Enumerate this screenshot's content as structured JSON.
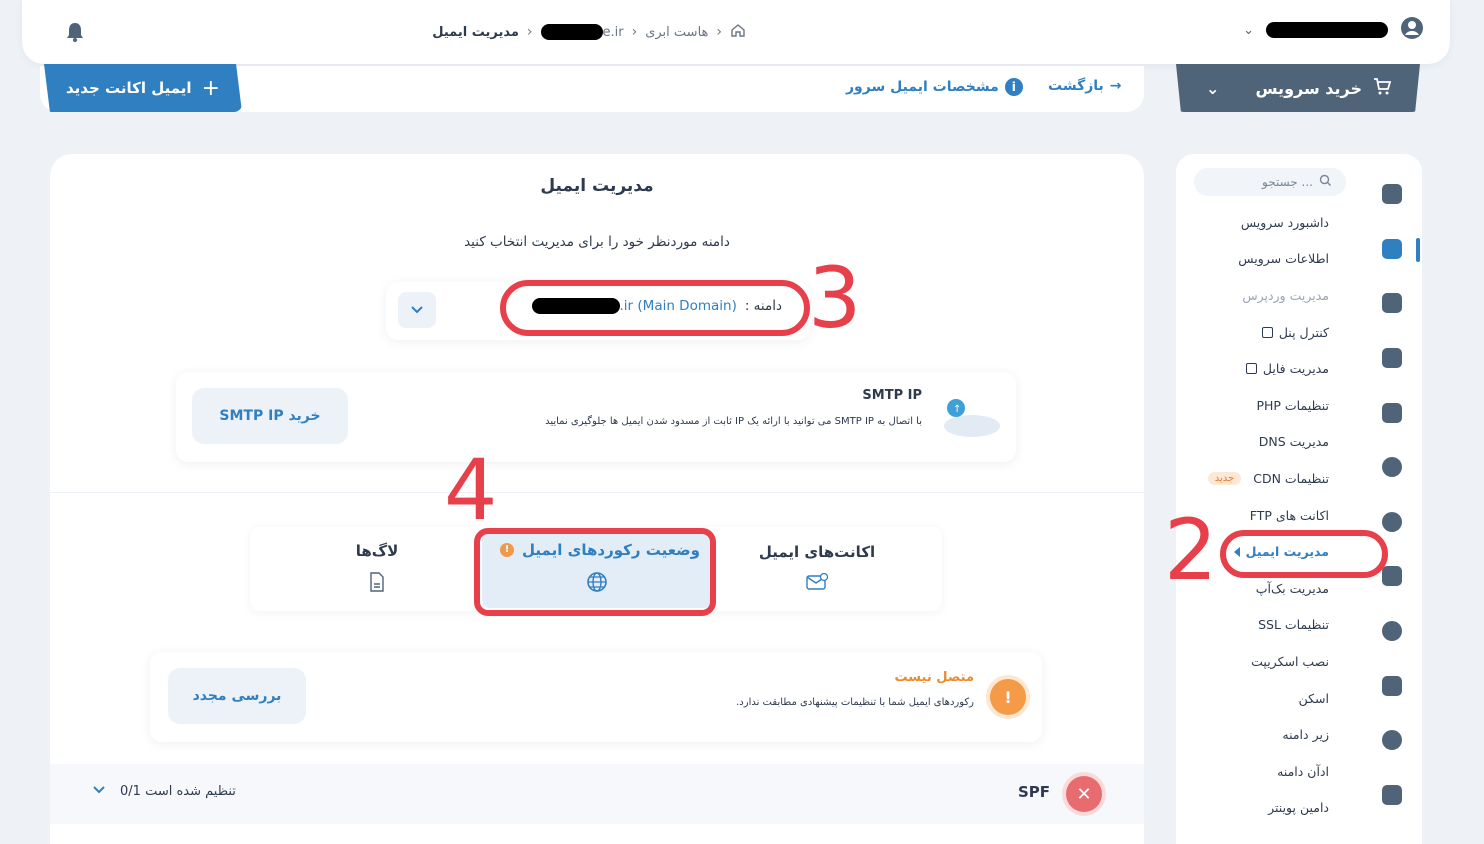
{
  "breadcrumb": {
    "current": "مدیریت ایمیل",
    "domain_suffix": "e.ir",
    "parent": "هاست ابری"
  },
  "header": {
    "user_name": "████",
    "back": "بازگشت",
    "server_info": "مشخصات ایمیل سرور",
    "new_email_account": "ایمیل اکانت جدید",
    "buy_service": "خرید سرویس"
  },
  "sidebar": {
    "search_placeholder": "جستجو ...",
    "items": [
      {
        "label": "داشبورد سرویس"
      },
      {
        "label": "اطلاعات سرویس"
      },
      {
        "label": "مدیریت وردپرس"
      },
      {
        "label": "کنترل پنل"
      },
      {
        "label": "مدیریت فایل"
      },
      {
        "label": "تنظیمات PHP"
      },
      {
        "label": "مدیریت DNS"
      },
      {
        "label": "تنظیمات CDN",
        "badge": "جدید"
      },
      {
        "label": "اکانت های FTP"
      },
      {
        "label": "مدیریت ایمیل"
      },
      {
        "label": "مدیریت بک‌آپ"
      },
      {
        "label": "تنظیمات SSL"
      },
      {
        "label": "نصب اسکریپت"
      },
      {
        "label": "اسکن"
      },
      {
        "label": "زیر دامنه"
      },
      {
        "label": "ادآن دامنه"
      },
      {
        "label": "دامین پوینتر"
      }
    ]
  },
  "main": {
    "title": "مدیریت ایمیل",
    "subtitle": "دامنه موردنظر خود را برای مدیریت انتخاب کنید",
    "domain_label": "دامنه :",
    "domain_value": ".ir (Main Domain)",
    "smtp": {
      "title": "SMTP IP",
      "description": "با اتصال به SMTP IP می توانید با ارائه یک IP ثابت از مسدود شدن ایمیل ها جلوگیری نمایید",
      "buy_button": "خرید SMTP IP"
    },
    "tabs": [
      {
        "label": "اکانت‌های ایمیل"
      },
      {
        "label": "وضعیت رکوردهای ایمیل"
      },
      {
        "label": "لاگ‌ها"
      }
    ],
    "status": {
      "title": "متصل نیست",
      "description": "رکوردهای ایمیل شما با تنظیمات پیشنهادی مطابقت ندارد.",
      "recheck_button": "بررسی مجدد"
    },
    "spf": {
      "label": "SPF",
      "status": "0/1 تنظیم شده است"
    }
  },
  "annotations": [
    "2",
    "3",
    "4"
  ]
}
